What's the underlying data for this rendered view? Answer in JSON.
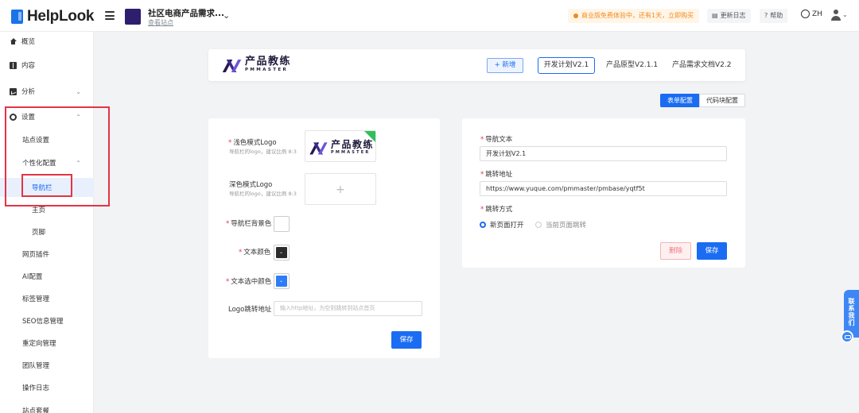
{
  "app": {
    "brand": "HelpLook"
  },
  "site": {
    "title": "社区电商产品需求...",
    "view_link": "查看站点"
  },
  "topbar": {
    "promo": "商业版免费体验中，还有1天，立即购买",
    "changelog": "更新日志",
    "help": "帮助",
    "lang": "ZH"
  },
  "sidebar": {
    "items": [
      {
        "label": "概览"
      },
      {
        "label": "内容"
      },
      {
        "label": "分析"
      },
      {
        "label": "设置"
      },
      {
        "label": "站点设置"
      },
      {
        "label": "个性化配置"
      },
      {
        "label": "导航栏"
      },
      {
        "label": "主页"
      },
      {
        "label": "页脚"
      },
      {
        "label": "网页插件"
      },
      {
        "label": "AI配置"
      },
      {
        "label": "标签管理"
      },
      {
        "label": "SEO信息管理"
      },
      {
        "label": "重定向管理"
      },
      {
        "label": "团队管理"
      },
      {
        "label": "操作日志"
      },
      {
        "label": "站点套餐"
      }
    ]
  },
  "preview": {
    "brand_cn": "产品教练",
    "brand_en": "PMMASTER",
    "add_button": "+ 新增",
    "tabs": [
      {
        "label": "开发计划V2.1"
      },
      {
        "label": "产品原型V2.1.1"
      },
      {
        "label": "产品需求文档V2.2"
      }
    ]
  },
  "config_switch": {
    "form": "表单配置",
    "code": "代码块配置"
  },
  "left_form": {
    "light_logo_label": "浅色模式Logo",
    "light_logo_hint": "导航栏的logo，建议比例 8:3",
    "dark_logo_label": "深色模式Logo",
    "dark_logo_hint": "导航栏的logo，建议比例 8:3",
    "bg_color_label": "导航栏背景色",
    "text_color_label": "文本颜色",
    "text_selected_color_label": "文本选中颜色",
    "logo_link_label": "Logo跳转地址",
    "logo_link_placeholder": "输入http地址，为空则跳转到站点首页",
    "save": "保存",
    "required_mark": "*",
    "upload_plus": "+"
  },
  "right_form": {
    "nav_text_label": "导航文本",
    "nav_text_value": "开发计划V2.1",
    "link_label": "跳转地址",
    "link_value": "https://www.yuque.com/pmmaster/pmbase/yqtf5t",
    "jump_mode_label": "跳转方式",
    "option_new": "新页面打开",
    "option_current": "当前页面跳转",
    "delete": "删除",
    "save": "保存"
  },
  "contact": {
    "label": "联系我们"
  },
  "colors": {
    "accent": "#1a6cf2",
    "highlight": "#e53345",
    "promo": "#f08a1c",
    "bg_color_value": "#ffffff",
    "text_color_value": "#2b2b2b",
    "text_selected_color_value": "#2f7df6"
  },
  "icons": {
    "overview": "home-icon",
    "content": "book-icon",
    "analytics": "chart-icon",
    "settings": "gear-icon",
    "menu": "menu-icon",
    "language": "globe-icon",
    "user": "user-icon"
  }
}
